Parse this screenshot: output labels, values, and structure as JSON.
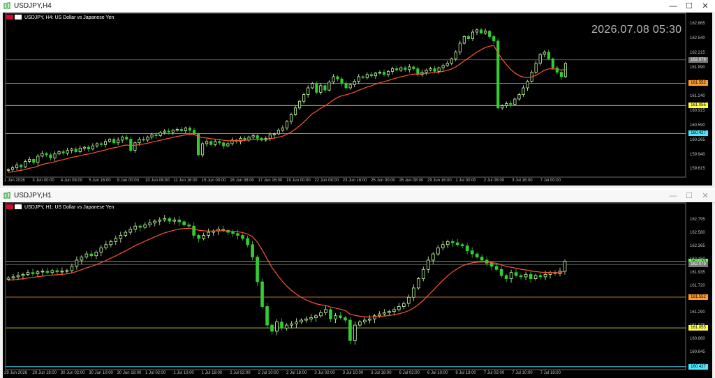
{
  "windows": [
    {
      "id": "h4",
      "title": "USDJPY,H4",
      "symbol_desc": "USDJPY, H4:  US Dollar vs Japanese Yen",
      "clock": "2026.07.08 05:30",
      "price_labels": [
        "162.865",
        "162.540",
        "162.215",
        "161.890",
        "161.565",
        "161.240",
        "160.915",
        "160.590",
        "160.265",
        "159.940",
        "159.615"
      ],
      "time_labels": [
        "1 Jun 2026",
        "3 Jun 00:00",
        "4 Jun 08:00",
        "5 Jun 16:00",
        "9 Jun 00:00",
        "10 Jun 08:00",
        "11 Jun 16:00",
        "15 Jun 00:00",
        "16 Jun 08:00",
        "17 Jun 16:00",
        "19 Jun 00:00",
        "22 Jun 08:00",
        "23 Jun 16:00",
        "25 Jun 00:00",
        "26 Jun 08:00",
        "29 Jun 16:00",
        "1 Jul 00:00",
        "2 Jul 08:00",
        "3 Jul 16:00",
        "7 Jul 00:00"
      ],
      "tags": [
        {
          "text": "162.079",
          "bg": "#7a7a7a",
          "fg": "#ffffff"
        },
        {
          "text": "161.552",
          "bg": "#ff9a2e",
          "fg": "#000000"
        },
        {
          "text": "161.055",
          "bg": "#ffff44",
          "fg": "#000000"
        },
        {
          "text": "160.427",
          "bg": "#4de8ff",
          "fg": "#000000"
        }
      ]
    },
    {
      "id": "h1",
      "title": "USDJPY,H1",
      "symbol_desc": "USDJPY, H1:  US Dollar vs Japanese Yen",
      "price_labels": [
        "162.795",
        "162.580",
        "162.365",
        "162.150",
        "161.935",
        "161.720",
        "161.505",
        "161.290",
        "161.075",
        "160.860",
        "160.645",
        "160.430"
      ],
      "time_labels": [
        "29 Jun 2026",
        "29 Jun 18:00",
        "30 Jun 02:00",
        "30 Jun 10:00",
        "30 Jun 18:00",
        "1 Jul 02:00",
        "1 Jul 10:00",
        "1 Jul 18:00",
        "2 Jul 02:00",
        "2 Jul 10:00",
        "2 Jul 18:00",
        "3 Jul 02:00",
        "3 Jul 10:00",
        "3 Jul 18:00",
        "6 Jul 02:00",
        "6 Jul 10:00",
        "6 Jul 18:00",
        "7 Jul 02:00",
        "7 Jul 10:00",
        "7 Jul 18:00"
      ],
      "tags": [
        {
          "text": "162.130",
          "bg": "#66ff66",
          "fg": "#000000"
        },
        {
          "text": "162.079",
          "bg": "#7a7a7a",
          "fg": "#ffffff"
        },
        {
          "text": "161.552",
          "bg": "#ff9a2e",
          "fg": "#000000"
        },
        {
          "text": "161.055",
          "bg": "#ffff44",
          "fg": "#000000"
        },
        {
          "text": "160.427",
          "bg": "#4de8ff",
          "fg": "#000000"
        }
      ]
    }
  ],
  "colors": {
    "bull": "#ccffaa",
    "bear": "#33cc33",
    "ma": "#ff5533",
    "grid_price": "#7a7a7a",
    "orange": "#ff9a2e",
    "yellow": "#ffff44",
    "cyan": "#4de8ff",
    "green": "#66ff66"
  },
  "chart_data": [
    {
      "type": "candlestick",
      "title": "USDJPY,H4",
      "indicator": "moving average (red)",
      "ylim": [
        159.45,
        162.95
      ],
      "hlines": [
        162.079,
        161.552,
        161.055,
        160.427
      ],
      "close": [
        159.62,
        159.66,
        159.72,
        159.68,
        159.8,
        159.85,
        159.78,
        159.92,
        159.98,
        159.95,
        159.88,
        159.97,
        160.02,
        159.99,
        160.05,
        160.08,
        160.02,
        160.1,
        160.12,
        160.08,
        160.15,
        160.2,
        160.18,
        160.25,
        160.3,
        160.22,
        160.28,
        160.35,
        160.3,
        160.05,
        160.22,
        160.3,
        160.28,
        160.35,
        160.4,
        160.38,
        160.45,
        160.48,
        160.46,
        160.5,
        160.52,
        160.49,
        160.55,
        160.5,
        160.42,
        159.95,
        160.2,
        160.25,
        160.18,
        160.25,
        160.22,
        160.15,
        160.2,
        160.28,
        160.25,
        160.32,
        160.28,
        160.35,
        160.38,
        160.32,
        160.28,
        160.32,
        160.4,
        160.42,
        160.5,
        160.55,
        160.7,
        160.85,
        161.0,
        161.15,
        161.3,
        161.45,
        161.55,
        161.35,
        161.5,
        161.4,
        161.58,
        161.7,
        161.65,
        161.55,
        161.45,
        161.52,
        161.6,
        161.7,
        161.68,
        161.75,
        161.72,
        161.78,
        161.8,
        161.75,
        161.82,
        161.88,
        161.85,
        161.9,
        161.86,
        161.92,
        161.88,
        161.75,
        161.8,
        161.85,
        161.88,
        161.82,
        161.9,
        161.95,
        162.0,
        162.1,
        162.25,
        162.45,
        162.6,
        162.55,
        162.7,
        162.75,
        162.68,
        162.72,
        162.6,
        162.5,
        161.0,
        161.05,
        161.1,
        161.08,
        161.2,
        161.3,
        161.45,
        161.6,
        161.8,
        162.0,
        162.2,
        162.25,
        162.1,
        161.9,
        161.8,
        161.7,
        162.0
      ],
      "ma_first": 159.55,
      "ma_last": 161.6
    },
    {
      "type": "candlestick",
      "title": "USDJPY,H1",
      "indicator": "moving average (red)",
      "ylim": [
        160.38,
        162.95
      ],
      "hlines": [
        162.13,
        162.079,
        161.552,
        161.055,
        160.427
      ],
      "close": [
        161.86,
        161.88,
        161.9,
        161.92,
        161.95,
        161.93,
        161.96,
        161.97,
        161.95,
        161.98,
        161.96,
        161.97,
        161.98,
        162.05,
        162.15,
        162.2,
        162.25,
        162.22,
        162.28,
        162.35,
        162.4,
        162.45,
        162.5,
        162.55,
        162.6,
        162.65,
        162.7,
        162.68,
        162.72,
        162.75,
        162.78,
        162.8,
        162.82,
        162.78,
        162.8,
        162.77,
        162.72,
        162.7,
        162.55,
        162.5,
        162.55,
        162.6,
        162.62,
        162.65,
        162.63,
        162.6,
        162.58,
        162.55,
        162.5,
        162.4,
        162.2,
        161.8,
        161.4,
        161.1,
        161.0,
        161.15,
        161.05,
        161.1,
        161.12,
        161.15,
        161.18,
        161.2,
        161.22,
        161.25,
        161.3,
        161.35,
        161.2,
        161.25,
        161.22,
        161.18,
        160.85,
        161.1,
        161.15,
        161.18,
        161.2,
        161.25,
        161.28,
        161.3,
        161.32,
        161.35,
        161.4,
        161.45,
        161.55,
        161.7,
        161.85,
        162.0,
        162.15,
        162.25,
        162.35,
        162.4,
        162.45,
        162.43,
        162.4,
        162.38,
        162.3,
        162.25,
        162.2,
        162.15,
        162.1,
        162.05,
        162.0,
        161.9,
        161.85,
        161.95,
        161.9,
        161.88,
        161.92,
        161.85,
        161.9,
        161.88,
        161.92,
        161.95,
        161.93,
        161.97,
        162.13
      ],
      "ma_first": 161.82,
      "ma_last": 161.93
    }
  ]
}
